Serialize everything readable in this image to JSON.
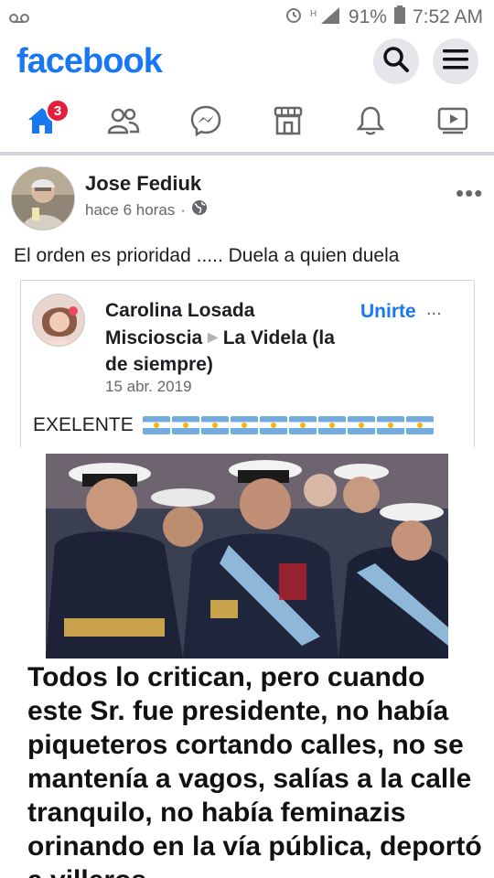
{
  "status_bar": {
    "battery": "91%",
    "time": "7:52 AM"
  },
  "header": {
    "logo": "facebook",
    "search_icon": "search-icon",
    "menu_icon": "hamburger-menu-icon"
  },
  "nav": {
    "items": [
      {
        "icon": "home-icon",
        "badge": "3",
        "active": true
      },
      {
        "icon": "friends-icon"
      },
      {
        "icon": "messenger-icon"
      },
      {
        "icon": "marketplace-icon"
      },
      {
        "icon": "bell-icon"
      },
      {
        "icon": "video-icon"
      }
    ]
  },
  "post": {
    "author": "Jose Fediuk",
    "time": "hace 6 horas",
    "separator": "·",
    "privacy_icon": "globe-icon",
    "more": "•••",
    "text": "El orden es prioridad ..... Duela a quien duela"
  },
  "shared_post": {
    "author": "Carolina Losada Miscioscia",
    "group": "La Videla (la de siempre)",
    "date": "15 abr. 2019",
    "join": "Unirte",
    "more": "...",
    "text": "EXELENTE",
    "flag_count": 10
  },
  "image_caption": "Todos lo critican, pero cuando este Sr. fue presidente, no había piqueteros cortando calles, no se mantenía a vagos, salías a la calle tranquilo, no había feminazis orinando en la vía pública, deportó a villeros"
}
